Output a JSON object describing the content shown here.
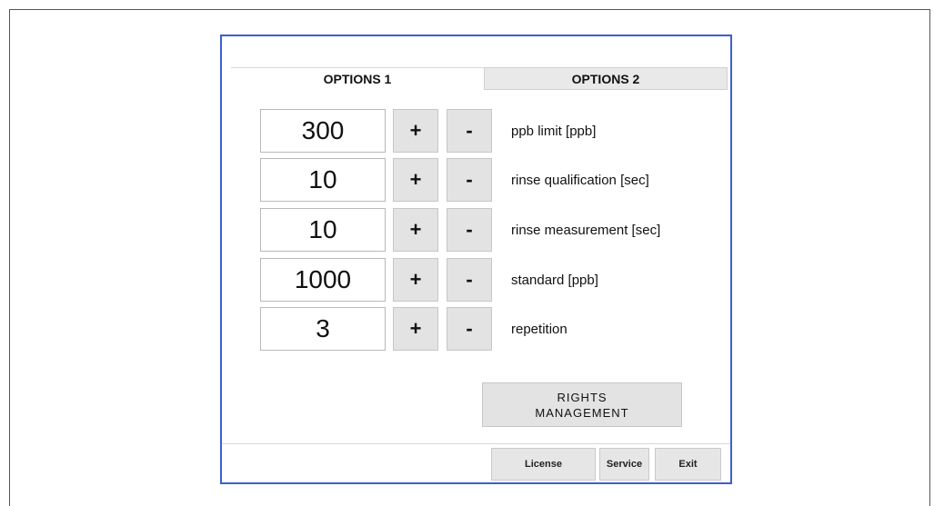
{
  "tabs": [
    {
      "label": "OPTIONS 1",
      "active": true
    },
    {
      "label": "OPTIONS 2",
      "active": false
    }
  ],
  "settings": [
    {
      "value": "300",
      "plus": "+",
      "minus": "-",
      "label": "ppb limit [ppb]"
    },
    {
      "value": "10",
      "plus": "+",
      "minus": "-",
      "label": "rinse qualification [sec]"
    },
    {
      "value": "10",
      "plus": "+",
      "minus": "-",
      "label": "rinse measurement [sec]"
    },
    {
      "value": "1000",
      "plus": "+",
      "minus": "-",
      "label": "standard [ppb]"
    },
    {
      "value": "3",
      "plus": "+",
      "minus": "-",
      "label": "repetition"
    }
  ],
  "rights_management": {
    "line1": "RIGHTS",
    "line2": "MANAGEMENT"
  },
  "footer": {
    "license": "License",
    "service": "Service",
    "exit": "Exit"
  },
  "colors": {
    "dialog_border": "#3a5fd0",
    "button_bg": "#e3e3e3",
    "inactive_tab_bg": "#e9e9e9"
  }
}
